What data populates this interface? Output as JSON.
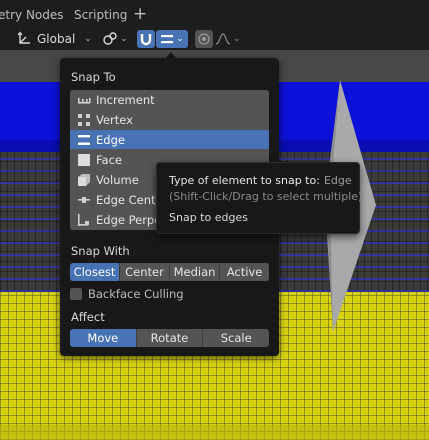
{
  "tabs": {
    "geometry_nodes": "etry Nodes",
    "scripting": "Scripting",
    "add": "+"
  },
  "toolbar": {
    "orientation": {
      "label": "Global",
      "icon": "transform-orientation-icon"
    },
    "pivot_icon": "pivot-link-icon",
    "snap_toggle_icon": "snap-magnet-icon",
    "snap_element_icon": "snap-edge-icon",
    "proportional_icon": "proportional-editing-icon",
    "falloff_icon": "falloff-curve-icon",
    "chevron": "⌄"
  },
  "popup": {
    "snap_to_title": "Snap To",
    "snap_to_items": [
      {
        "label": "Increment",
        "icon": "snap-increment-icon",
        "active": false
      },
      {
        "label": "Vertex",
        "icon": "snap-vertex-icon",
        "active": false
      },
      {
        "label": "Edge",
        "icon": "snap-edge-icon",
        "active": true
      },
      {
        "label": "Face",
        "icon": "snap-face-icon",
        "active": false
      },
      {
        "label": "Volume",
        "icon": "snap-volume-icon",
        "active": false
      },
      {
        "label": "Edge Center",
        "icon": "snap-edge-center-icon",
        "active": false
      },
      {
        "label": "Edge Perpen",
        "icon": "snap-edge-perpendicular-icon",
        "active": false
      }
    ],
    "snap_with_title": "Snap With",
    "snap_with_options": [
      "Closest",
      "Center",
      "Median",
      "Active"
    ],
    "snap_with_selected": "Closest",
    "backface_culling": {
      "label": "Backface Culling",
      "checked": false
    },
    "affect_title": "Affect",
    "affect_options": [
      "Move",
      "Rotate",
      "Scale"
    ],
    "affect_selected": "Move"
  },
  "tooltip": {
    "line1_prefix": "Type of element to snap to:",
    "line1_value": "Edge",
    "line2": "(Shift-Click/Drag to select multiple)",
    "line3": "Snap to edges"
  },
  "colors": {
    "accent": "#4772b3",
    "popup_bg": "#181818",
    "button_bg": "#545454",
    "viewport_blue": "#0c10d8",
    "viewport_yellow": "#d8d212"
  }
}
